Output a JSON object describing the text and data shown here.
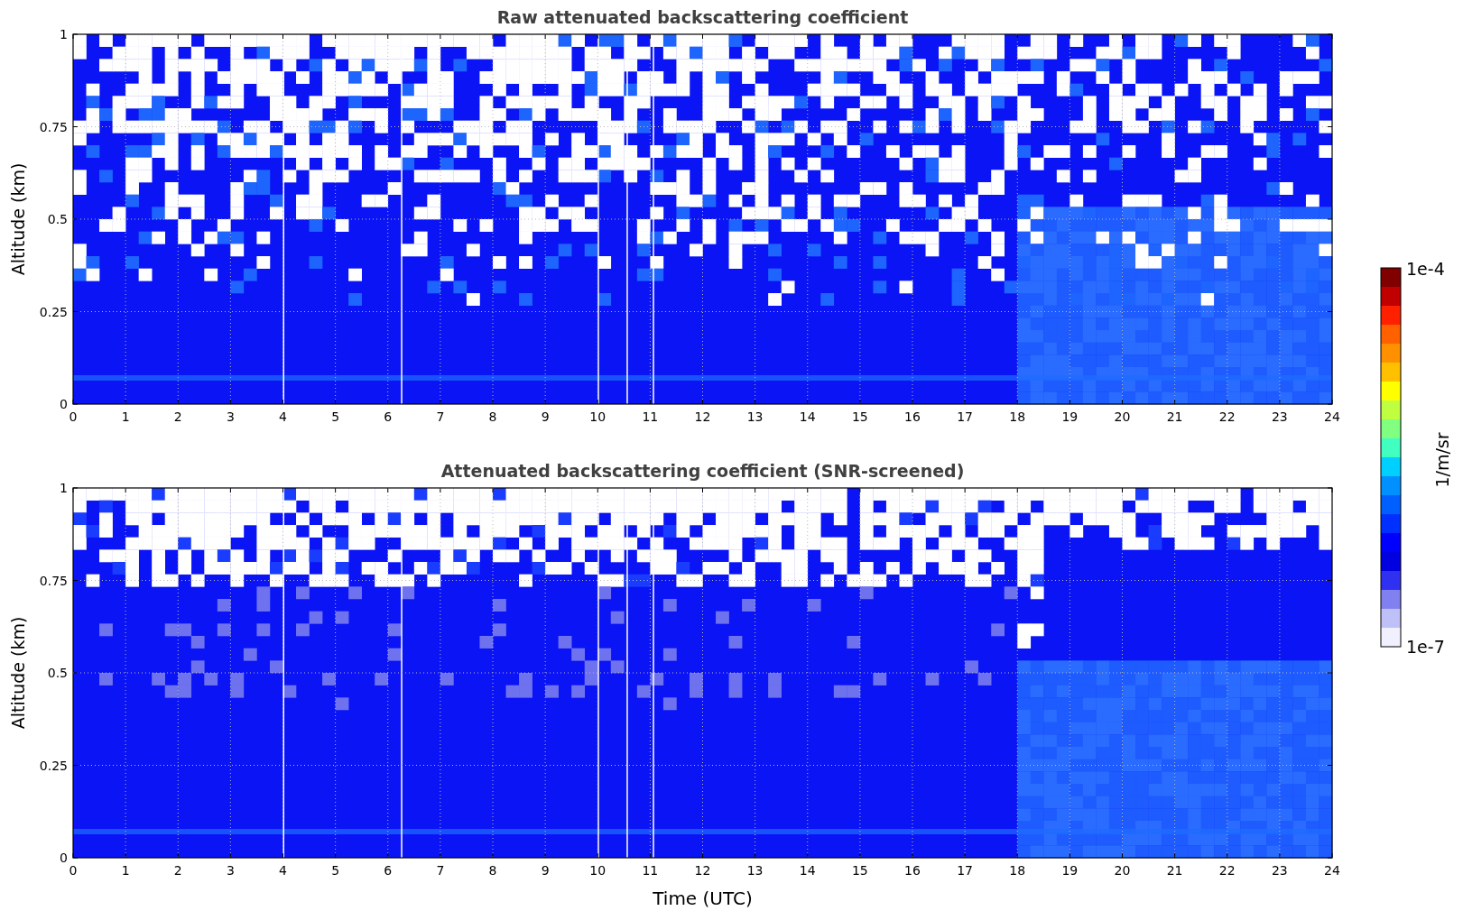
{
  "panels": [
    {
      "title": "Raw attenuated backscattering coefficient",
      "ylabel": "Altitude (km)",
      "screened": false,
      "yticks": [
        "1",
        "0.75",
        "0.5",
        "0.25",
        "0"
      ],
      "xticks": [
        "0",
        "1",
        "2",
        "3",
        "4",
        "5",
        "6",
        "7",
        "8",
        "9",
        "10",
        "11",
        "12",
        "13",
        "14",
        "15",
        "16",
        "17",
        "18",
        "19",
        "20",
        "21",
        "22",
        "23",
        "24"
      ]
    },
    {
      "title": "Attenuated backscattering coefficient (SNR-screened)",
      "ylabel": "Altitude (km)",
      "xlabel": "Time (UTC)",
      "screened": true,
      "yticks": [
        "1",
        "0.75",
        "0.5",
        "0.25",
        "0"
      ],
      "xticks": [
        "0",
        "1",
        "2",
        "3",
        "4",
        "5",
        "6",
        "7",
        "8",
        "9",
        "10",
        "11",
        "12",
        "13",
        "14",
        "15",
        "16",
        "17",
        "18",
        "19",
        "20",
        "21",
        "22",
        "23",
        "24"
      ]
    }
  ],
  "colorbar": {
    "max": "1e-4",
    "min": "1e-7",
    "label": "1/m/sr"
  }
}
